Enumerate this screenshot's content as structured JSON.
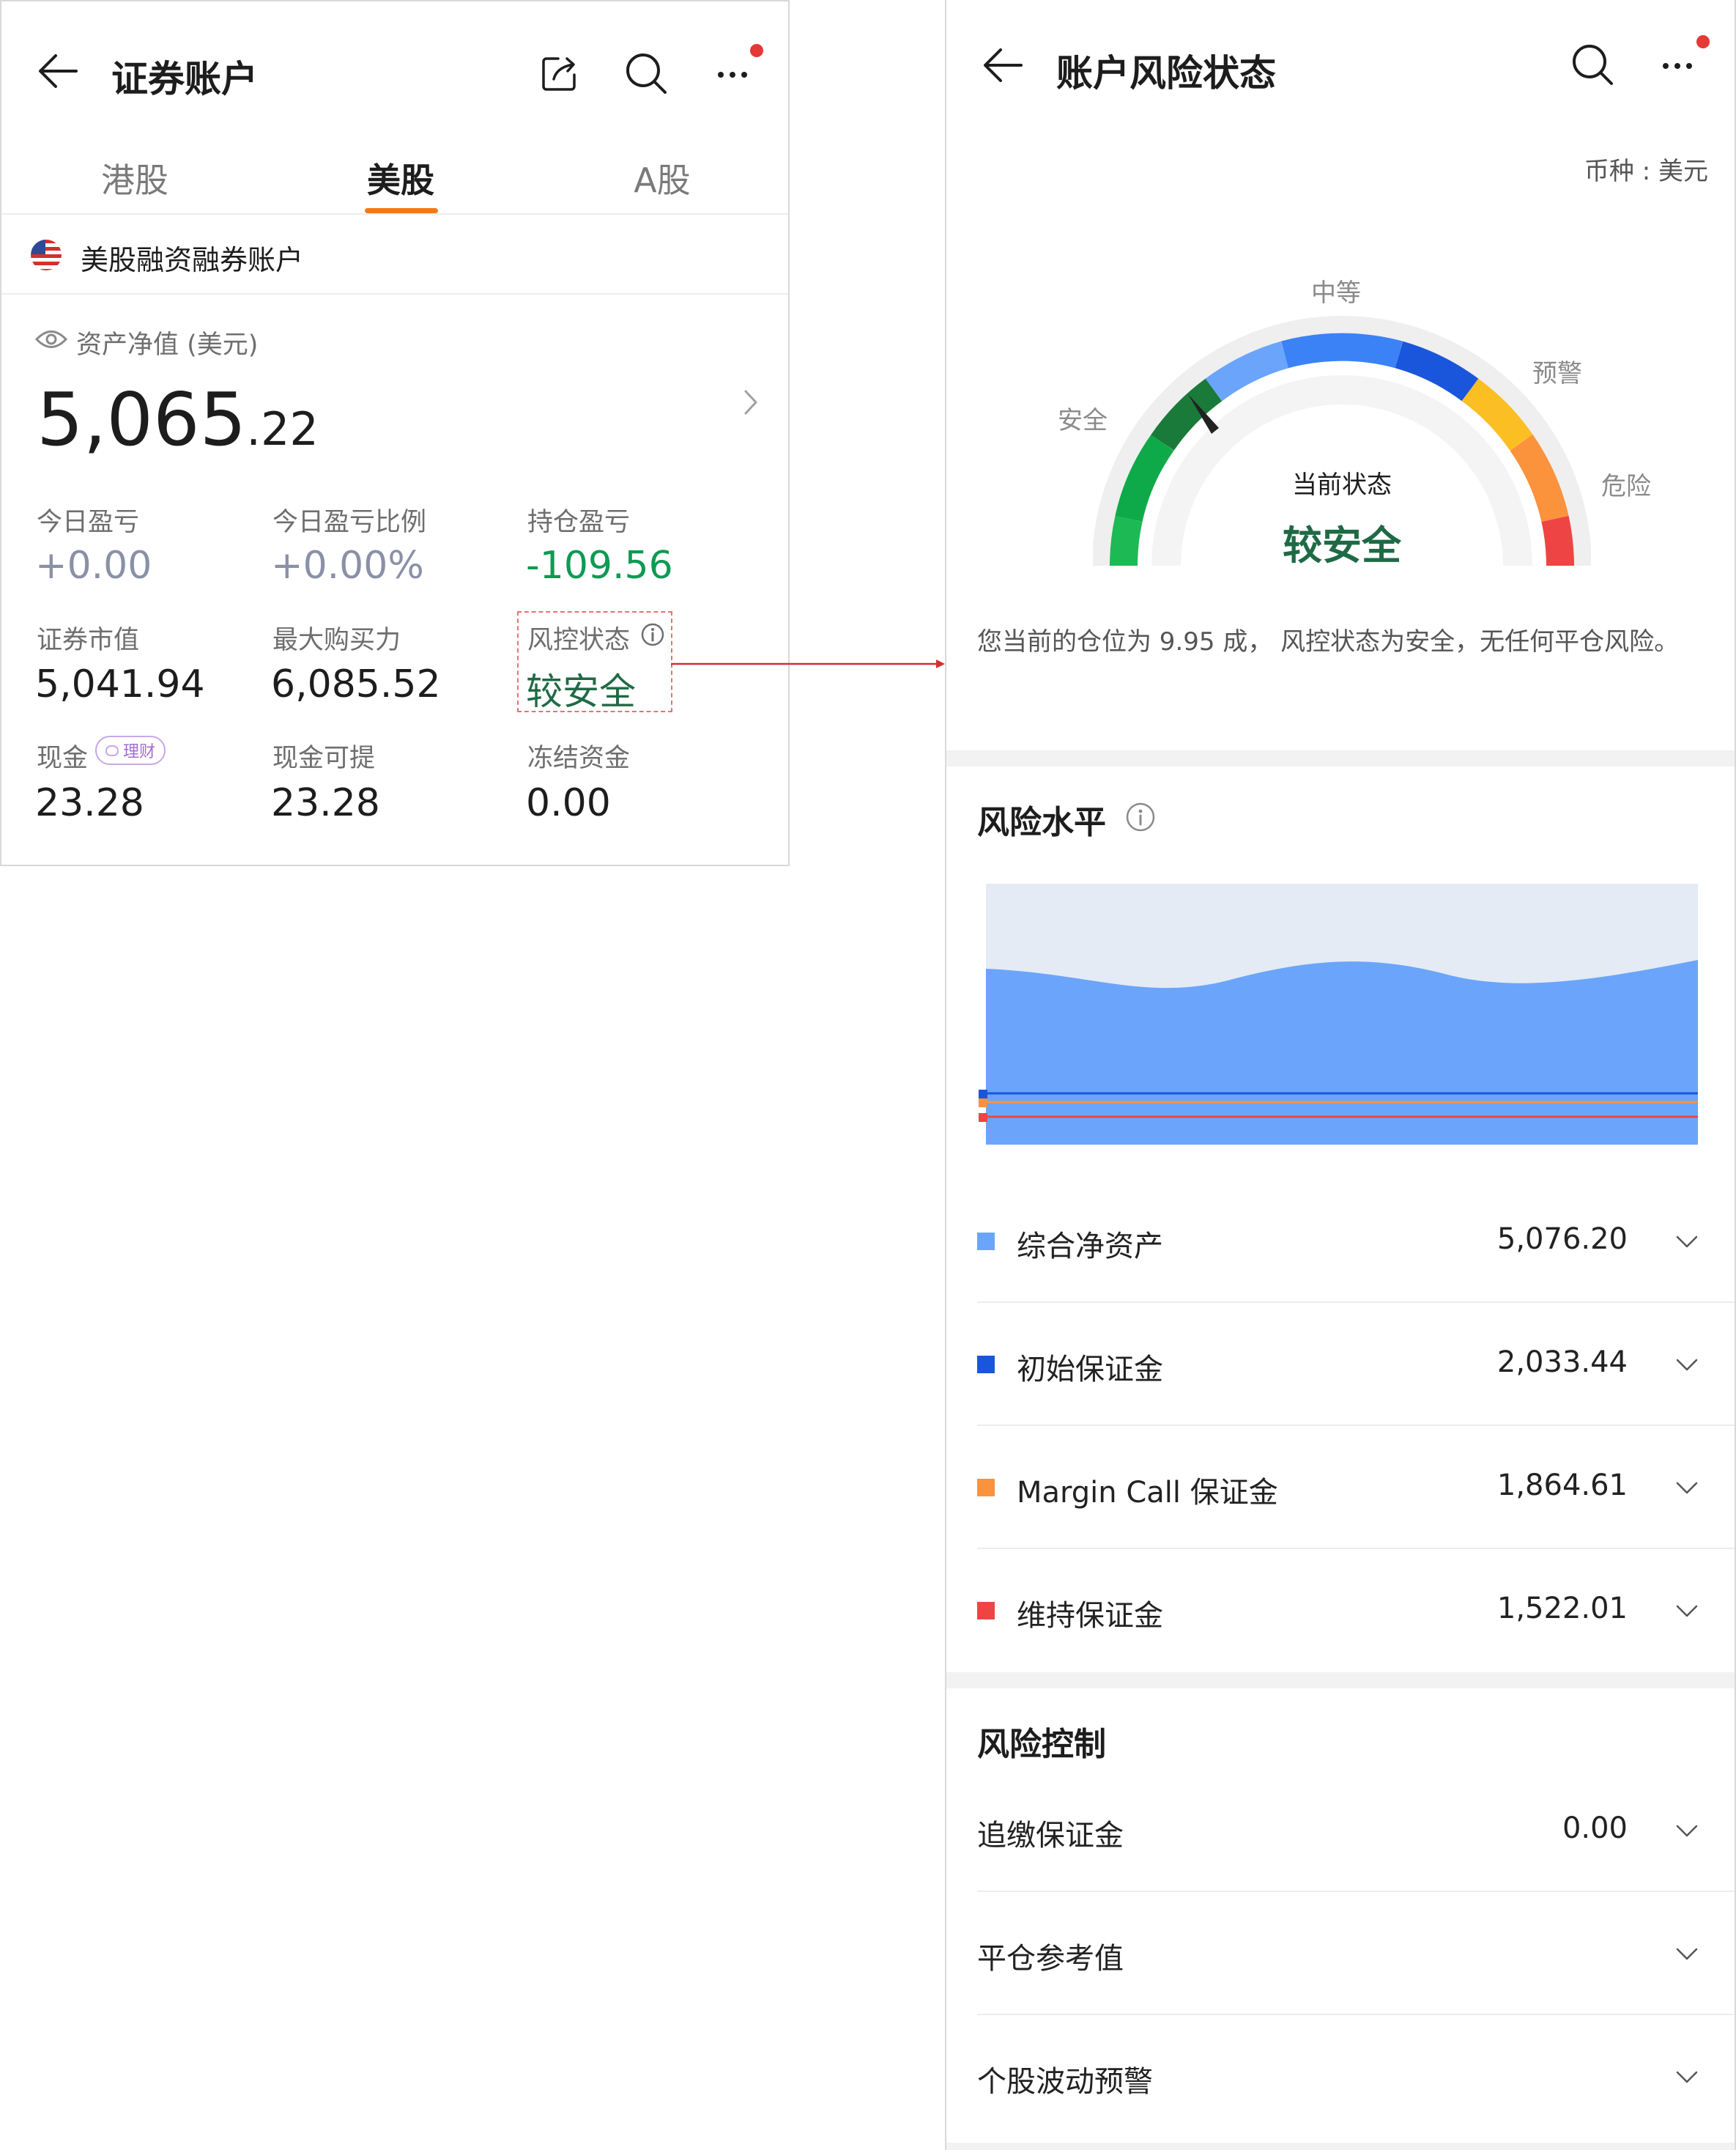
{
  "left": {
    "title": "证券账户",
    "tabs": [
      {
        "label": "港股",
        "active": false
      },
      {
        "label": "美股",
        "active": true
      },
      {
        "label": "A股",
        "active": false
      }
    ],
    "account_name": "美股融资融券账户",
    "net_asset_label": "资产净值 (美元)",
    "net_asset_int": "5,065",
    "net_asset_dec": ".22",
    "stats": [
      {
        "label": "今日盈亏",
        "value": "+0.00"
      },
      {
        "label": "今日盈亏比例",
        "value": "+0.00%"
      },
      {
        "label": "持仓盈亏",
        "value": "-109.56"
      },
      {
        "label": "证券市值",
        "value": "5,041.94"
      },
      {
        "label": "最大购买力",
        "value": "6,085.52"
      },
      {
        "label": "风控状态",
        "value": "较安全"
      },
      {
        "label": "现金",
        "value": "23.28",
        "badge": "理财"
      },
      {
        "label": "现金可提",
        "value": "23.28"
      },
      {
        "label": "冻结资金",
        "value": "0.00"
      }
    ]
  },
  "right": {
    "title": "账户风险状态",
    "currency": "币种 : 美元",
    "gauge": {
      "labels": {
        "safe": "安全",
        "medium": "中等",
        "warning": "预警",
        "danger": "危险"
      },
      "current_label": "当前状态",
      "current_value": "较安全"
    },
    "description": "您当前的仓位为 9.95 成， 风控状态为安全，无任何平仓风险。",
    "risk_level": {
      "title": "风险水平",
      "items": [
        {
          "label": "综合净资产",
          "value": "5,076.20",
          "color": "#6aa5fb"
        },
        {
          "label": "初始保证金",
          "value": "2,033.44",
          "color": "#1a56db"
        },
        {
          "label": "Margin Call 保证金",
          "value": "1,864.61",
          "color": "#fb923c"
        },
        {
          "label": "维持保证金",
          "value": "1,522.01",
          "color": "#ef4444"
        }
      ]
    },
    "risk_control": {
      "title": "风险控制",
      "items": [
        {
          "label": "追缴保证金",
          "value": "0.00"
        },
        {
          "label": "平仓参考值",
          "value": ""
        },
        {
          "label": "个股波动预警",
          "value": ""
        }
      ]
    }
  },
  "colors": {
    "accent_orange": "#f07a1a",
    "safe_green": "#0d9a52",
    "dark_green": "#1a7a3a",
    "notification_red": "#e53935",
    "connector_red": "#d32f2f"
  }
}
